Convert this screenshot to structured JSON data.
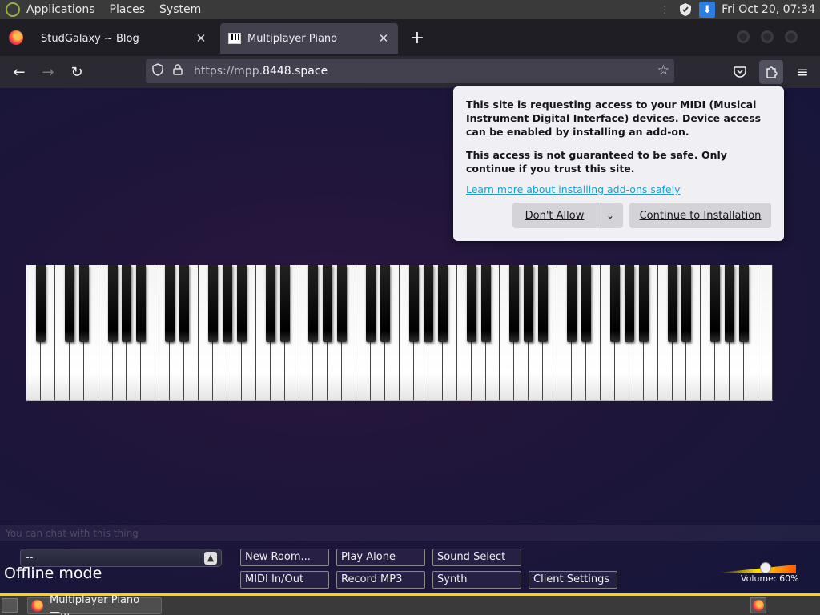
{
  "system_panel": {
    "menus": [
      "Applications",
      "Places",
      "System"
    ],
    "clock": "Fri Oct 20, 07:34"
  },
  "tabs": [
    {
      "title": "StudGalaxy ~ Blog",
      "active": false
    },
    {
      "title": "Multiplayer Piano",
      "active": true
    }
  ],
  "navbar": {
    "url_prefix": "https://mpp.",
    "url_domain": "8448.space"
  },
  "popup": {
    "message": "This site is requesting access to your MIDI (Musical Instrument Digital Interface) devices. Device access can be enabled by installing an add-on.",
    "warning": "This access is not guaranteed to be safe. Only continue if you trust this site.",
    "learn_more": "Learn more about installing add-ons safely",
    "dont_allow": "Don't Allow",
    "continue": "Continue to Installation"
  },
  "chat": {
    "placeholder": "You can chat with this thing"
  },
  "controls": {
    "room_value": "--",
    "status": "Offline mode",
    "buttons": {
      "new_room": "New Room...",
      "play_alone": "Play Alone",
      "sound_select": "Sound Select",
      "midi": "MIDI In/Out",
      "record": "Record MP3",
      "synth": "Synth",
      "client_settings": "Client Settings"
    },
    "volume_label": "Volume: 60%",
    "volume_level": 0.6
  },
  "taskbar": {
    "task_title": "Multiplayer Piano —..."
  },
  "piano": {
    "white_keys": 52
  }
}
